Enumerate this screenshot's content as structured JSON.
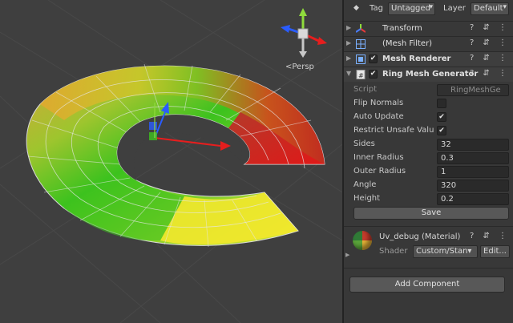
{
  "scene": {
    "view_label": "<Persp",
    "gizmo_axes": [
      "y",
      "x",
      "z"
    ]
  },
  "inspector": {
    "tag_label": "Tag",
    "tag_value": "Untagged",
    "layer_label": "Layer",
    "layer_value": "Default",
    "components": [
      {
        "name": "Transform",
        "icon": "transform-icon"
      },
      {
        "name": "(Mesh Filter)",
        "icon": "mesh-filter-icon"
      },
      {
        "name": "Mesh Renderer",
        "icon": "mesh-renderer-icon",
        "enabled": true
      },
      {
        "name": "Ring Mesh Generator",
        "icon": "script-icon",
        "enabled": true
      }
    ],
    "ring": {
      "script_label": "Script",
      "script_value": "RingMeshGe",
      "flip_normals_label": "Flip Normals",
      "flip_normals": false,
      "auto_update_label": "Auto Update",
      "auto_update": true,
      "restrict_label": "Restrict Unsafe Valu",
      "restrict": true,
      "sides_label": "Sides",
      "sides": "32",
      "inner_radius_label": "Inner Radius",
      "inner_radius": "0.3",
      "outer_radius_label": "Outer Radius",
      "outer_radius": "1",
      "angle_label": "Angle",
      "angle": "320",
      "height_label": "Height",
      "height": "0.2",
      "save_label": "Save"
    },
    "material": {
      "name": "Uv_debug (Material)",
      "shader_label": "Shader",
      "shader_value": "Custom/Stan",
      "edit_label": "Edit..."
    },
    "add_component_label": "Add Component",
    "check_glyph": "✔",
    "tools_glyph": "? ⇵ ⋮"
  },
  "colors": {
    "panel_bg": "#383838",
    "scene_bg": "#3f3f3f",
    "ring_red": "#c41e1e",
    "ring_green": "#34c21c",
    "ring_yellow": "#f2e82c"
  }
}
